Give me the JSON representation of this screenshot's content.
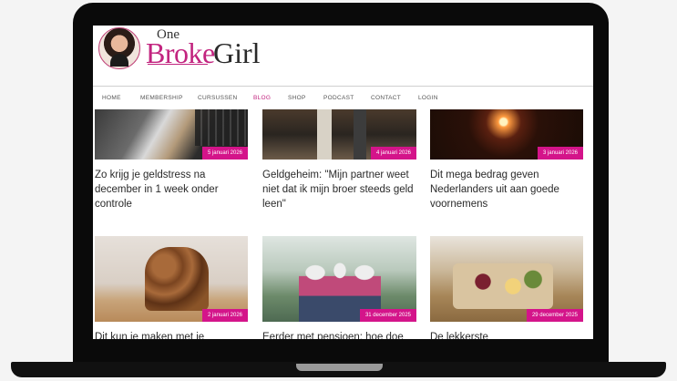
{
  "site": {
    "logo_one": "One",
    "logo_broke": "Broke",
    "logo_girl": "Girl"
  },
  "nav": {
    "items": [
      "HOME",
      "MEMBERSHIP",
      "CURSUSSEN",
      "BLOG",
      "SHOP",
      "PODCAST",
      "CONTACT",
      "LOGIN"
    ],
    "active": "BLOG"
  },
  "posts": [
    {
      "date": "5 januari 2026",
      "title": "Zo krijg je geldstress na december in 1 week onder controle"
    },
    {
      "date": "4 januari 2026",
      "title": "Geldgeheim: \"Mijn partner weet niet dat ik mijn broer steeds geld leen\""
    },
    {
      "date": "3 januari 2026",
      "title": "Dit mega bedrag geven Nederlanders uit aan goede voornemens"
    },
    {
      "date": "2 januari 2026",
      "title": "Dit kun je maken met je"
    },
    {
      "date": "31 december 2025",
      "title": "Eerder met pensioen: hoe doe"
    },
    {
      "date": "29 december 2025",
      "title": "De lekkerste"
    }
  ],
  "colors": {
    "accent": "#c2247f",
    "date_badge": "#d4148a"
  }
}
